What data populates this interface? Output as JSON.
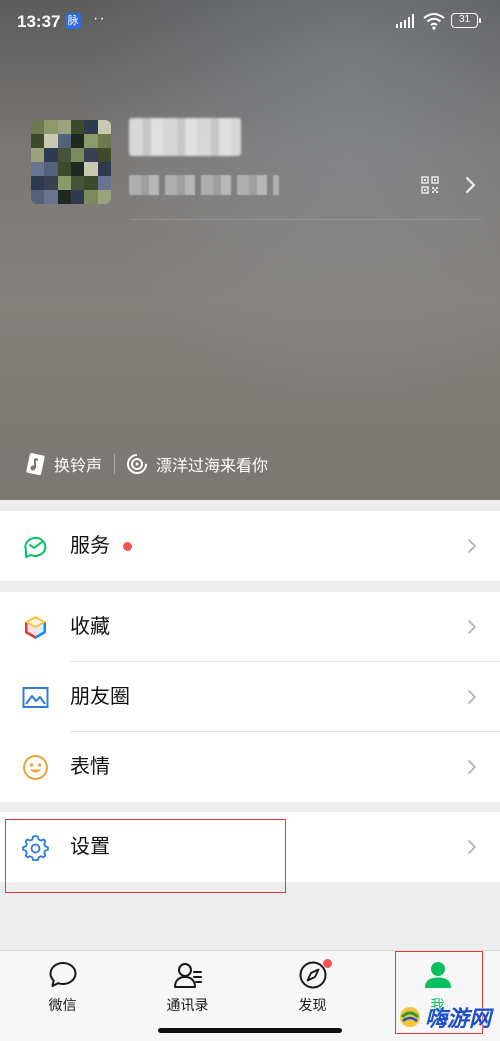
{
  "status_bar": {
    "time": "13:37",
    "app_badge": "脉",
    "dots": "··",
    "battery": "31"
  },
  "profile": {
    "nickname": "",
    "wechat_id": ""
  },
  "status_row": {
    "ringtone_label": "换铃声",
    "song_label": "漂洋过海来看你"
  },
  "menu": {
    "services": {
      "label": "服务",
      "icon": "services-icon"
    },
    "favorites": {
      "label": "收藏",
      "icon": "favorites-cube-icon"
    },
    "moments": {
      "label": "朋友圈",
      "icon": "moments-image-icon"
    },
    "stickers": {
      "label": "表情",
      "icon": "smiley-icon"
    },
    "settings": {
      "label": "设置",
      "icon": "gear-icon"
    }
  },
  "tabbar": {
    "tabs": [
      {
        "label": "微信",
        "icon": "chat-bubble-icon"
      },
      {
        "label": "通讯录",
        "icon": "contacts-icon"
      },
      {
        "label": "发现",
        "icon": "compass-icon"
      },
      {
        "label": "我",
        "icon": "me-person-icon"
      }
    ],
    "active_index": 3
  },
  "watermark": {
    "text": "嗨游网"
  },
  "colors": {
    "accent_green": "#07c160",
    "red_dot": "#fa5151",
    "highlight_box": "#e03a3a"
  }
}
